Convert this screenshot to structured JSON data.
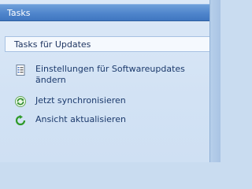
{
  "header": {
    "title": "Tasks"
  },
  "section": {
    "title": "Tasks für Updates"
  },
  "tasks": [
    {
      "label_line1": "Einstellungen für Softwareupdates",
      "label_line2": "ändern",
      "icon": "settings-list-icon"
    },
    {
      "label": "Jetzt synchronisieren",
      "icon": "sync-icon"
    },
    {
      "label": "Ansicht aktualisieren",
      "icon": "refresh-icon"
    }
  ],
  "colors": {
    "header": "#4f85cc",
    "panel": "#d2e2f4",
    "text": "#1c3a6c"
  }
}
